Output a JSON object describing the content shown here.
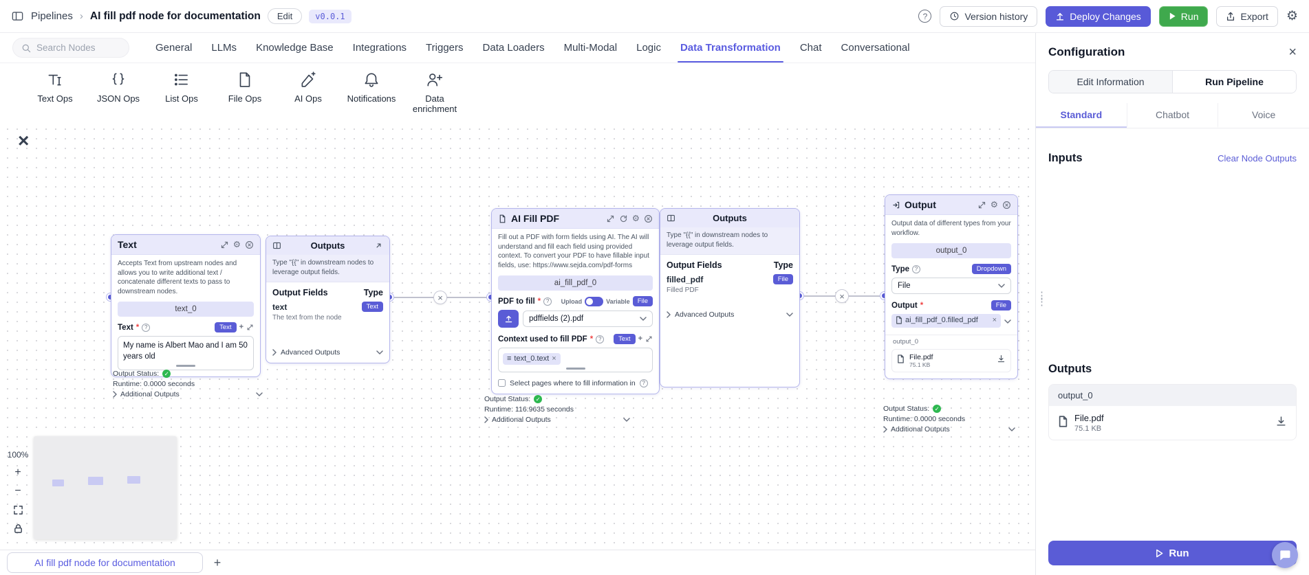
{
  "header": {
    "breadcrumb_root": "Pipelines",
    "breadcrumb_sep": "›",
    "title": "AI fill pdf node for documentation",
    "edit": "Edit",
    "version": "v0.0.1",
    "help": "?",
    "version_history": "Version history",
    "deploy": "Deploy Changes",
    "run": "Run",
    "export": "Export"
  },
  "toolbar": {
    "search_placeholder": "Search Nodes",
    "tabs": [
      "General",
      "LLMs",
      "Knowledge Base",
      "Integrations",
      "Triggers",
      "Data Loaders",
      "Multi-Modal",
      "Logic",
      "Data Transformation",
      "Chat",
      "Conversational"
    ]
  },
  "palette": {
    "items": [
      "Text Ops",
      "JSON Ops",
      "List Ops",
      "File Ops",
      "AI Ops",
      "Notifications",
      "Data enrichment"
    ]
  },
  "misc": {
    "required": "*"
  },
  "canvas": {
    "zoom": "100%",
    "zoom_in": "+",
    "zoom_out": "−",
    "text_node": {
      "title": "Text",
      "description": "Accepts Text from upstream nodes and allows you to write additional text / concatenate different texts to pass to downstream nodes.",
      "field_id": "text_0",
      "label": "Text",
      "badge": "Text",
      "value": "My name is Albert Mao and I am 50 years old",
      "status_label": "Output Status:",
      "runtime": "Runtime: 0.0000 seconds",
      "additional": "Additional Outputs"
    },
    "text_outputs": {
      "title": "Outputs",
      "hint": "Type \"{{\" in downstream nodes to leverage output fields.",
      "col_fields": "Output Fields",
      "col_type": "Type",
      "row_name": "text",
      "row_type": "Text",
      "row_desc": "The text from the node",
      "advanced": "Advanced Outputs"
    },
    "ai_node": {
      "title": "AI Fill PDF",
      "description": "Fill out a PDF with form fields using AI. The AI will understand and fill each field using provided context. To convert your PDF to have fillable input fields, use: https://www.sejda.com/pdf-forms",
      "field_id": "ai_fill_pdf_0",
      "pdf_label": "PDF to fill",
      "upload": "Upload",
      "variable": "Variable",
      "file_badge": "File",
      "file_name": "pdffields (2).pdf",
      "context_label": "Context used to fill PDF",
      "text_badge": "Text",
      "token": "text_0.text",
      "checkbox_label": "Select pages where to fill information in",
      "status_label": "Output Status:",
      "runtime": "Runtime: 116.9635 seconds",
      "additional": "Additional Outputs"
    },
    "ai_outputs": {
      "title": "Outputs",
      "hint": "Type \"{{\" in downstream nodes to leverage output fields.",
      "col_fields": "Output Fields",
      "col_type": "Type",
      "row_name": "filled_pdf",
      "row_type": "File",
      "row_desc": "Filled PDF",
      "advanced": "Advanced Outputs"
    },
    "output_node": {
      "title": "Output",
      "description": "Output data of different types from your workflow.",
      "field_id": "output_0",
      "type_label": "Type",
      "type_badge": "Dropdown",
      "type_value": "File",
      "output_label": "Output",
      "output_badge": "File",
      "token": "ai_fill_pdf_0.filled_pdf",
      "section": "output_0",
      "file_name": "File.pdf",
      "file_size": "75.1 KB",
      "status_label": "Output Status:",
      "runtime": "Runtime: 0.0000 seconds",
      "additional": "Additional Outputs"
    }
  },
  "bottom": {
    "tab": "AI fill pdf node for documentation",
    "add": "+"
  },
  "config": {
    "title": "Configuration",
    "tab_edit": "Edit Information",
    "tab_run": "Run Pipeline",
    "mode_standard": "Standard",
    "mode_chatbot": "Chatbot",
    "mode_voice": "Voice",
    "inputs_title": "Inputs",
    "clear_outputs": "Clear Node Outputs",
    "outputs_title": "Outputs",
    "output_group": "output_0",
    "file_name": "File.pdf",
    "file_size": "75.1 KB",
    "run": "Run"
  }
}
